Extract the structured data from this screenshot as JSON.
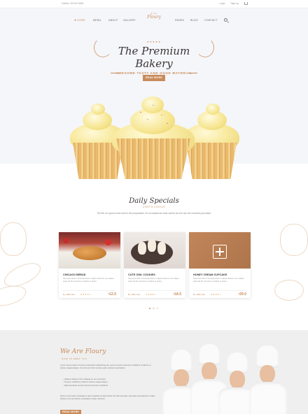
{
  "topbar": {
    "phone": "Hotline: 08 522 9605",
    "links": [
      "Login",
      "Sign up"
    ],
    "cart_icon": "cart-icon"
  },
  "nav": {
    "left": [
      "Home",
      "Menu",
      "About",
      "Gallery"
    ],
    "logo": "Floury",
    "right": [
      "Pages",
      "Blog",
      "Contact"
    ],
    "search_icon": "search-icon"
  },
  "hero": {
    "title": "The Premium Bakery",
    "subtitle": "AWESOME TASTY AND GOOD MATERIAL",
    "button": "READ MORE"
  },
  "specials": {
    "title": "Daily Specials",
    "subtitle": "CHEF'S CHOICE",
    "description": "The life of a good cook must in the preparation of a scrumptious meal cannot as one can the cosmetic purchase."
  },
  "cards": [
    {
      "title": "CHICAGO BREAD",
      "text": "Sed quis cillum consequunturm magna dolorem eos aliqua quae ab illo inventore veritatis et quasi",
      "by": "By: Jaffelt Vane",
      "rating": "★★★★☆",
      "price_symbol": "$",
      "price": "12.5"
    },
    {
      "title": "CUTE OWL COOKIES",
      "text": "Sed quis cillum consequunturm magna dolorem eos aliqua quae ab illo inventore veritatis et quasi",
      "by": "By: Jaffelt Vane",
      "rating": "★★★★☆",
      "price_symbol": "$",
      "price": "18.5"
    },
    {
      "title": "HONEY CREAM CUPCAKE",
      "text": "Sed quis cillum consequunturm magna dolorem eos aliqua quae ab illo inventore veritatis et quasi",
      "by": "By: Jaffelt Vane",
      "rating": "★★★★☆",
      "price_symbol": "$",
      "price": "29.0"
    }
  ],
  "about": {
    "title": "We Are Floury",
    "subtitle": "NICE TO MEET YOU",
    "para": "Lorem ipsum dolor sit amet consectetur adipisicing elit, sed do eiusmod tempor incididunt ut labore et dolore magna aliqua. Ut enim ad minim veniam quis nostrud exercitation.",
    "list": [
      "Ullamco laboris nisi ut aliquip ex ea commodo",
      "Tempor incididunt ut labore dolore magna aliqua",
      "Reprehenderit sed do eiusmod tempor incididunt"
    ],
    "para2": "Nemo enim ipsam voluptatem quia voluptas sit aspernatur aut odit aut fugit, sed quia consequuntur magni dolores eos qui ratione voluptatem sequi nesciunt.",
    "button": "READ MORE"
  },
  "colors": {
    "accent": "#c98b5a",
    "hero_bg": "#f5f6fa",
    "dark_text": "#3b3434"
  }
}
